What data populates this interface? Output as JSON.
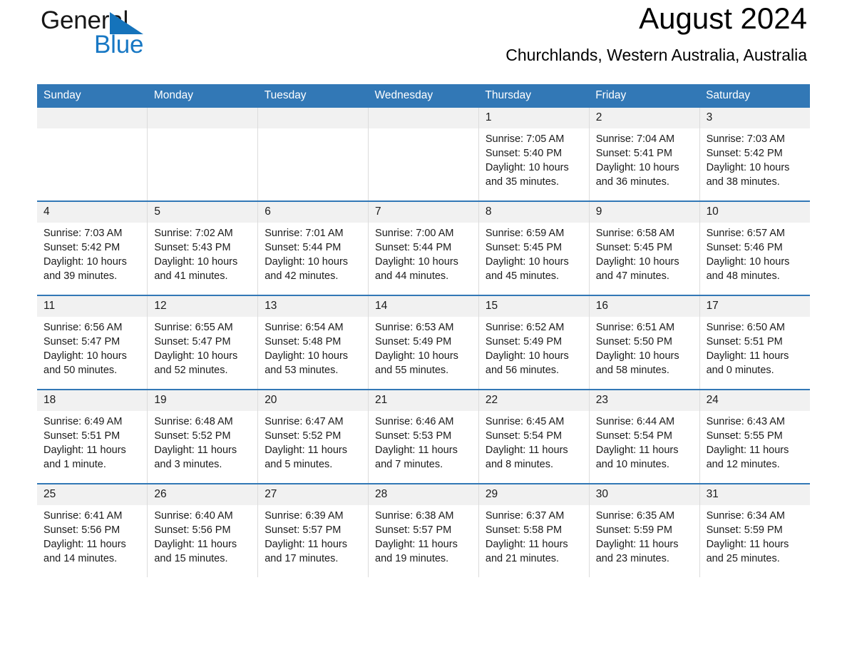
{
  "brand": {
    "name_part1": "General",
    "name_part2": "Blue",
    "triangle_icon": "triangle-icon",
    "accent_color": "#1878c4"
  },
  "header": {
    "month_title": "August 2024",
    "location": "Churchlands, Western Australia, Australia",
    "header_bg_color": "#3278b6",
    "daynum_bg_color": "#f1f1f1"
  },
  "calendar": {
    "weekday_headers": [
      "Sunday",
      "Monday",
      "Tuesday",
      "Wednesday",
      "Thursday",
      "Friday",
      "Saturday"
    ],
    "labels": {
      "sunrise_prefix": "Sunrise:",
      "sunset_prefix": "Sunset:",
      "daylight_prefix": "Daylight:"
    },
    "weeks": [
      [
        {
          "day": "",
          "sunrise": "",
          "sunset": "",
          "daylight": ""
        },
        {
          "day": "",
          "sunrise": "",
          "sunset": "",
          "daylight": ""
        },
        {
          "day": "",
          "sunrise": "",
          "sunset": "",
          "daylight": ""
        },
        {
          "day": "",
          "sunrise": "",
          "sunset": "",
          "daylight": ""
        },
        {
          "day": "1",
          "sunrise": "Sunrise: 7:05 AM",
          "sunset": "Sunset: 5:40 PM",
          "daylight": "Daylight: 10 hours and 35 minutes."
        },
        {
          "day": "2",
          "sunrise": "Sunrise: 7:04 AM",
          "sunset": "Sunset: 5:41 PM",
          "daylight": "Daylight: 10 hours and 36 minutes."
        },
        {
          "day": "3",
          "sunrise": "Sunrise: 7:03 AM",
          "sunset": "Sunset: 5:42 PM",
          "daylight": "Daylight: 10 hours and 38 minutes."
        }
      ],
      [
        {
          "day": "4",
          "sunrise": "Sunrise: 7:03 AM",
          "sunset": "Sunset: 5:42 PM",
          "daylight": "Daylight: 10 hours and 39 minutes."
        },
        {
          "day": "5",
          "sunrise": "Sunrise: 7:02 AM",
          "sunset": "Sunset: 5:43 PM",
          "daylight": "Daylight: 10 hours and 41 minutes."
        },
        {
          "day": "6",
          "sunrise": "Sunrise: 7:01 AM",
          "sunset": "Sunset: 5:44 PM",
          "daylight": "Daylight: 10 hours and 42 minutes."
        },
        {
          "day": "7",
          "sunrise": "Sunrise: 7:00 AM",
          "sunset": "Sunset: 5:44 PM",
          "daylight": "Daylight: 10 hours and 44 minutes."
        },
        {
          "day": "8",
          "sunrise": "Sunrise: 6:59 AM",
          "sunset": "Sunset: 5:45 PM",
          "daylight": "Daylight: 10 hours and 45 minutes."
        },
        {
          "day": "9",
          "sunrise": "Sunrise: 6:58 AM",
          "sunset": "Sunset: 5:45 PM",
          "daylight": "Daylight: 10 hours and 47 minutes."
        },
        {
          "day": "10",
          "sunrise": "Sunrise: 6:57 AM",
          "sunset": "Sunset: 5:46 PM",
          "daylight": "Daylight: 10 hours and 48 minutes."
        }
      ],
      [
        {
          "day": "11",
          "sunrise": "Sunrise: 6:56 AM",
          "sunset": "Sunset: 5:47 PM",
          "daylight": "Daylight: 10 hours and 50 minutes."
        },
        {
          "day": "12",
          "sunrise": "Sunrise: 6:55 AM",
          "sunset": "Sunset: 5:47 PM",
          "daylight": "Daylight: 10 hours and 52 minutes."
        },
        {
          "day": "13",
          "sunrise": "Sunrise: 6:54 AM",
          "sunset": "Sunset: 5:48 PM",
          "daylight": "Daylight: 10 hours and 53 minutes."
        },
        {
          "day": "14",
          "sunrise": "Sunrise: 6:53 AM",
          "sunset": "Sunset: 5:49 PM",
          "daylight": "Daylight: 10 hours and 55 minutes."
        },
        {
          "day": "15",
          "sunrise": "Sunrise: 6:52 AM",
          "sunset": "Sunset: 5:49 PM",
          "daylight": "Daylight: 10 hours and 56 minutes."
        },
        {
          "day": "16",
          "sunrise": "Sunrise: 6:51 AM",
          "sunset": "Sunset: 5:50 PM",
          "daylight": "Daylight: 10 hours and 58 minutes."
        },
        {
          "day": "17",
          "sunrise": "Sunrise: 6:50 AM",
          "sunset": "Sunset: 5:51 PM",
          "daylight": "Daylight: 11 hours and 0 minutes."
        }
      ],
      [
        {
          "day": "18",
          "sunrise": "Sunrise: 6:49 AM",
          "sunset": "Sunset: 5:51 PM",
          "daylight": "Daylight: 11 hours and 1 minute."
        },
        {
          "day": "19",
          "sunrise": "Sunrise: 6:48 AM",
          "sunset": "Sunset: 5:52 PM",
          "daylight": "Daylight: 11 hours and 3 minutes."
        },
        {
          "day": "20",
          "sunrise": "Sunrise: 6:47 AM",
          "sunset": "Sunset: 5:52 PM",
          "daylight": "Daylight: 11 hours and 5 minutes."
        },
        {
          "day": "21",
          "sunrise": "Sunrise: 6:46 AM",
          "sunset": "Sunset: 5:53 PM",
          "daylight": "Daylight: 11 hours and 7 minutes."
        },
        {
          "day": "22",
          "sunrise": "Sunrise: 6:45 AM",
          "sunset": "Sunset: 5:54 PM",
          "daylight": "Daylight: 11 hours and 8 minutes."
        },
        {
          "day": "23",
          "sunrise": "Sunrise: 6:44 AM",
          "sunset": "Sunset: 5:54 PM",
          "daylight": "Daylight: 11 hours and 10 minutes."
        },
        {
          "day": "24",
          "sunrise": "Sunrise: 6:43 AM",
          "sunset": "Sunset: 5:55 PM",
          "daylight": "Daylight: 11 hours and 12 minutes."
        }
      ],
      [
        {
          "day": "25",
          "sunrise": "Sunrise: 6:41 AM",
          "sunset": "Sunset: 5:56 PM",
          "daylight": "Daylight: 11 hours and 14 minutes."
        },
        {
          "day": "26",
          "sunrise": "Sunrise: 6:40 AM",
          "sunset": "Sunset: 5:56 PM",
          "daylight": "Daylight: 11 hours and 15 minutes."
        },
        {
          "day": "27",
          "sunrise": "Sunrise: 6:39 AM",
          "sunset": "Sunset: 5:57 PM",
          "daylight": "Daylight: 11 hours and 17 minutes."
        },
        {
          "day": "28",
          "sunrise": "Sunrise: 6:38 AM",
          "sunset": "Sunset: 5:57 PM",
          "daylight": "Daylight: 11 hours and 19 minutes."
        },
        {
          "day": "29",
          "sunrise": "Sunrise: 6:37 AM",
          "sunset": "Sunset: 5:58 PM",
          "daylight": "Daylight: 11 hours and 21 minutes."
        },
        {
          "day": "30",
          "sunrise": "Sunrise: 6:35 AM",
          "sunset": "Sunset: 5:59 PM",
          "daylight": "Daylight: 11 hours and 23 minutes."
        },
        {
          "day": "31",
          "sunrise": "Sunrise: 6:34 AM",
          "sunset": "Sunset: 5:59 PM",
          "daylight": "Daylight: 11 hours and 25 minutes."
        }
      ]
    ]
  }
}
